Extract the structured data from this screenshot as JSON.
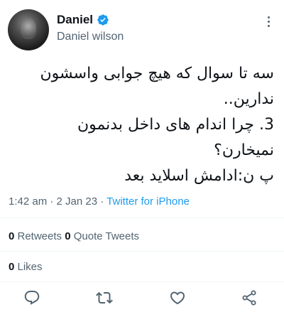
{
  "author": {
    "display_name": "Daniel",
    "handle": "Daniel wilson",
    "verified": true,
    "verified_color": "#1d9bf0"
  },
  "tweet": {
    "lines": [
      "سه تا سوال که هیچ جوابی واسشون",
      "ندارین..",
      "3.   چرا اندام های داخل بدنمون",
      "نمیخارن؟",
      "پ ن:ادامش اسلاید بعد"
    ]
  },
  "meta": {
    "time": "1:42 am",
    "separator": " · ",
    "date": "2 Jan 23",
    "source": "Twitter for iPhone"
  },
  "stats": {
    "retweets_count": "0",
    "retweets_label": " Retweets ",
    "quote_count": "0",
    "quote_label": " Quote Tweets",
    "likes_count": "0",
    "likes_label": " Likes"
  },
  "icons": {
    "more": "more-dots-icon",
    "reply": "reply-icon",
    "retweet": "retweet-icon",
    "like": "heart-icon",
    "share": "share-icon"
  },
  "colors": {
    "text": "#0f1419",
    "muted": "#536471",
    "accent": "#1d9bf0",
    "divider": "#eff3f4"
  }
}
